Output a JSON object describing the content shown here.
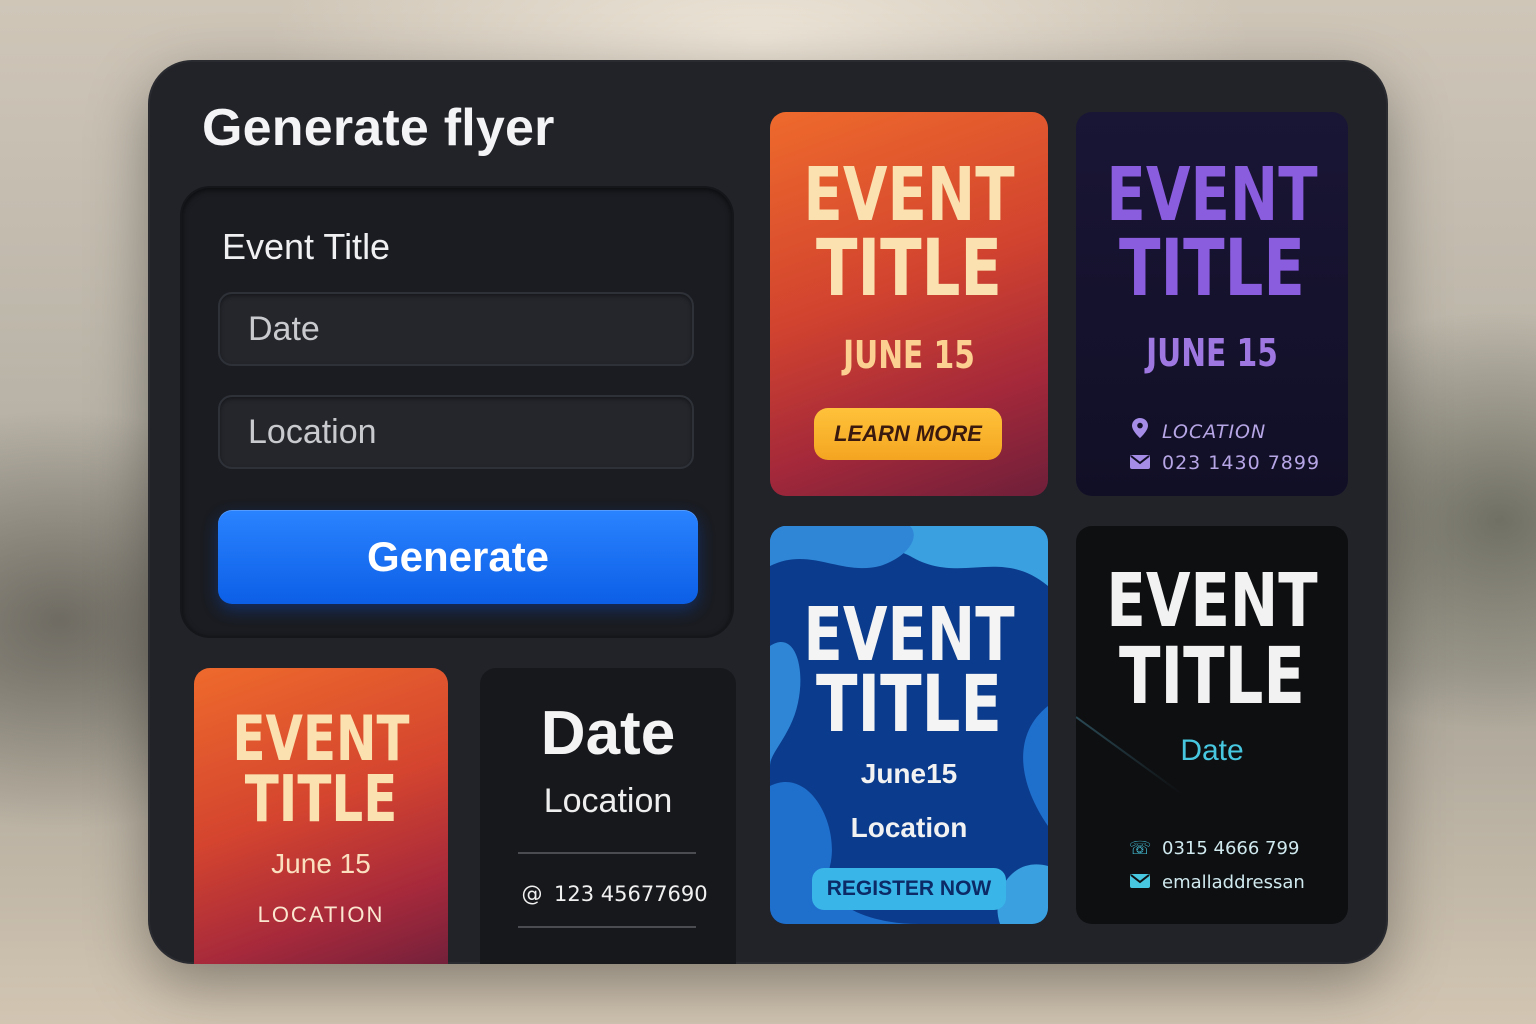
{
  "app": {
    "title": "Generate flyer"
  },
  "form": {
    "label": "Event Title",
    "date_placeholder": "Date",
    "location_placeholder": "Location",
    "generate_label": "Generate"
  },
  "flyers": [
    {
      "style": "orange",
      "line1": "EVENT",
      "line2": "TITLE",
      "date": "JUNE 15",
      "button": "LEARN MORE"
    },
    {
      "style": "purple",
      "line1": "EVENT",
      "line2": "TITLE",
      "date": "JUNE 15",
      "location": "LOCATION",
      "phone": "023 1430 7899",
      "location_icon": "pin-icon",
      "phone_icon": "envelope-icon"
    },
    {
      "style": "blue",
      "line1": "EVENT",
      "line2": "TITLE",
      "date": "June15",
      "location": "Location",
      "button": "REGISTER NOW"
    },
    {
      "style": "black",
      "line1": "EVENT",
      "line2": "TITLE",
      "date": "Date",
      "phone": "0315 4666 799",
      "email": "emalladdressan",
      "phone_icon": "phone-icon",
      "email_icon": "envelope-icon"
    },
    {
      "style": "orange-small",
      "line1": "EVENT",
      "line2": "TITLE",
      "date": "June 15",
      "location": "LOCATION"
    },
    {
      "style": "dark",
      "date": "Date",
      "location": "Location",
      "phone": "123 45677690",
      "phone_icon": "at-icon"
    }
  ],
  "colors": {
    "accent": "#1468f0",
    "panel": "#212329",
    "orange": "#e5532c",
    "purple": "#8a5cde",
    "cyan": "#47c7e0"
  }
}
